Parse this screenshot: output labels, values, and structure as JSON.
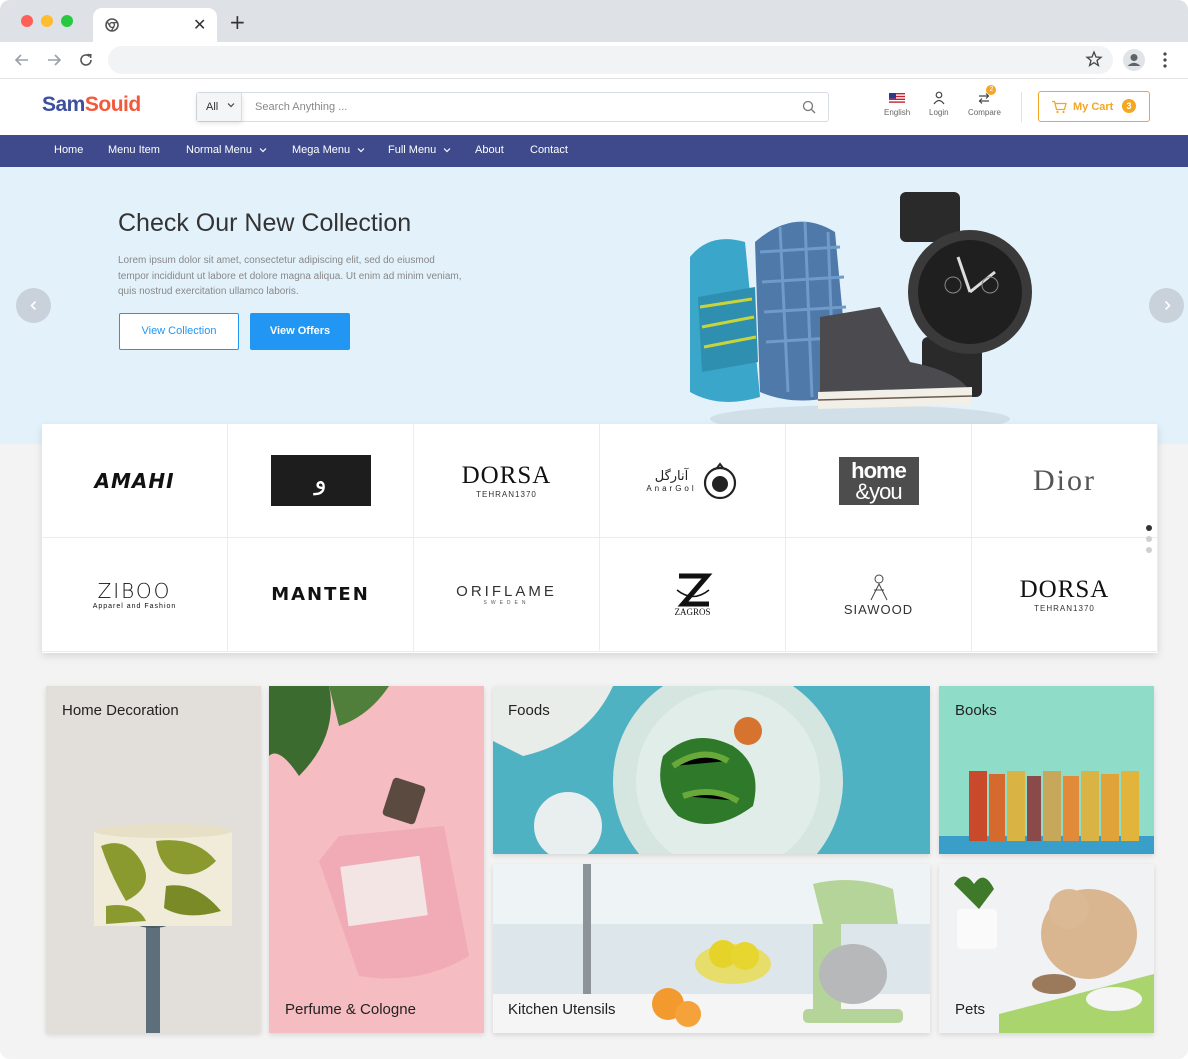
{
  "browser": {
    "tab_title": "",
    "url": ""
  },
  "header": {
    "logo_part1": "Sam",
    "logo_part2": "Souid",
    "search_category": "All",
    "search_placeholder": "Search Anything ...",
    "language_label": "English",
    "login_label": "Login",
    "compare_label": "Compare",
    "compare_count": "2",
    "cart_label": "My Cart",
    "cart_count": "3",
    "colors": {
      "primary": "#3e4a8c",
      "accent": "#f5a623",
      "button": "#2196f3"
    }
  },
  "nav": {
    "items": [
      {
        "label": "Home"
      },
      {
        "label": "Menu Item"
      },
      {
        "label": "Normal Menu"
      },
      {
        "label": "Mega Menu"
      },
      {
        "label": "Full Menu"
      },
      {
        "label": "About"
      },
      {
        "label": "Contact"
      }
    ]
  },
  "hero": {
    "title": "Check Our New Collection",
    "text": "Lorem ipsum dolor sit amet, consectetur adipiscing elit, sed do eiusmod tempor incididunt ut labore et dolore magna aliqua. Ut enim ad minim veniam, quis nostrud exercitation ullamco laboris.",
    "btn_collection": "View Collection",
    "btn_offers": "View Offers"
  },
  "brands": {
    "row1": [
      "AMAHI",
      "و",
      "DORSA",
      "TEHRAN1370",
      "آنارگل",
      "AnarGol",
      "home",
      "&you",
      "Dior"
    ],
    "row2": [
      "ZIBOO",
      "Apparel and Fashion",
      "MANTEN",
      "ORIFLAME",
      "SWEDEN",
      "ZAGROS",
      "SIAWOOD",
      "DORSA",
      "TEHRAN1370"
    ]
  },
  "categories": [
    {
      "label": "Home Decoration"
    },
    {
      "label": "Perfume & Cologne"
    },
    {
      "label": "Foods"
    },
    {
      "label": "Books"
    },
    {
      "label": "Kitchen Utensils"
    },
    {
      "label": "Pets"
    }
  ]
}
